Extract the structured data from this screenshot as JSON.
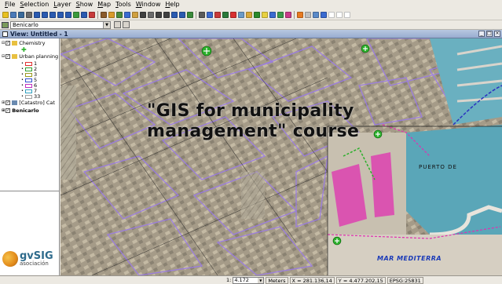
{
  "menubar": {
    "items": [
      "File",
      "Selection",
      "Layer",
      "Show",
      "Map",
      "Tools",
      "Window",
      "Help"
    ]
  },
  "toolbar": {
    "button_colors": [
      "#e8c020",
      "#4a7ab8",
      "#3a6a9a",
      "#6a6a6a",
      "#2a5ab0",
      "#2a5ab0",
      "#2a5ab0",
      "#2a5ab0",
      "#2a5ab0",
      "#3a9a3a",
      "#2a5ab0",
      "#c83a3a",
      "#8a5a2a",
      "#d89a2a",
      "#4a8a3a",
      "#3a6ad0",
      "#d0a040",
      "#404040",
      "#6a6a6a",
      "#404040",
      "#404040",
      "#2a5ab0",
      "#2a5ab0",
      "#3a8a3a",
      "#5a5a5a",
      "#3a6ad0",
      "#c83a3a",
      "#2a7a3a",
      "#d83030",
      "#6a9ac8",
      "#d8a838",
      "#2a8a2a",
      "#e8d040",
      "#3a6ad0",
      "#3a9a4a",
      "#c83a8a",
      "#e87a20",
      "#c0c0c0",
      "#5a8ac8",
      "#3a6ad0",
      "#ffffff",
      "#ffffff",
      "#ffffff"
    ]
  },
  "project_bar": {
    "selected_view": "Benicarlo"
  },
  "view_window": {
    "title": "View: Untitled - 1",
    "controls": [
      "minimize",
      "maximize",
      "close"
    ]
  },
  "toc": {
    "layers": [
      {
        "label": "Chemistry",
        "checked": true
      },
      {
        "label": "Urban planning",
        "checked": true
      },
      {
        "label": "[Catastro] Cat",
        "checked": true
      },
      {
        "label": "Benicarlo",
        "checked": true,
        "bold": true
      }
    ],
    "urban_legend": [
      {
        "label": "1",
        "color": "#e03030"
      },
      {
        "label": "2",
        "color": "#30a030"
      },
      {
        "label": "3",
        "color": "#9a9a20"
      },
      {
        "label": "5",
        "color": "#3050d0"
      },
      {
        "label": "6",
        "color": "#c030c0"
      },
      {
        "label": "7",
        "color": "#30a0c0"
      },
      {
        "label": "33",
        "color": "#a0a0a0"
      }
    ]
  },
  "overlay": {
    "course_title_line1": "\"GIS for municipality",
    "course_title_line2": "management\" course"
  },
  "map_labels": {
    "sea": "MAR MEDITERRA",
    "port": "PUERTO DE"
  },
  "logo": {
    "brand": "gvSIG",
    "subtitle": "asociación"
  },
  "statusbar": {
    "scale_prefix": "1:",
    "scale_value": "4.172",
    "units": "Meters",
    "x_coord": "X = 281.136,14",
    "y_coord": "Y = 4.477.202,15",
    "crs": "EPSG:25831"
  },
  "colors": {
    "urban_block_outline": "#9a7ae8",
    "cadastre_lines": "#1a1a1a",
    "port_highlight": "#e030b0",
    "harbor_sea": "#5aa6b8",
    "green_marker": "#2ab02a"
  }
}
